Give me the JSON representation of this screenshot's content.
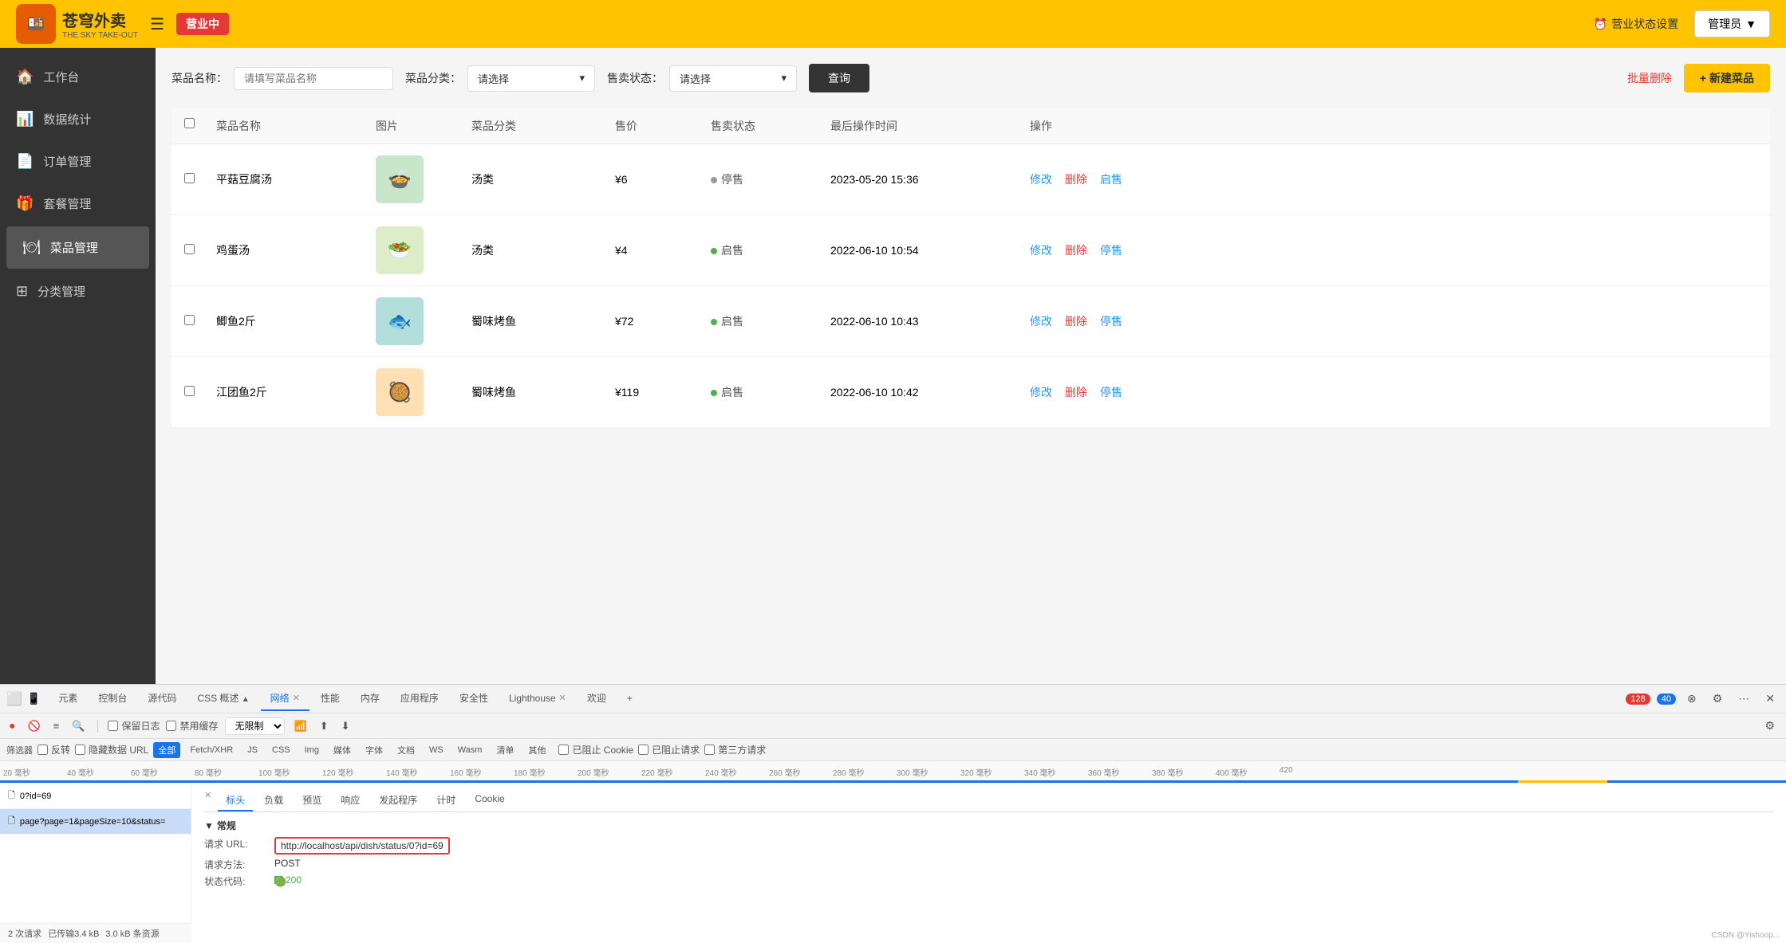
{
  "header": {
    "logo_cn": "苍穹外卖",
    "logo_en": "THE SKY TAKE-OUT",
    "menu_icon": "☰",
    "status_badge": "营业中",
    "business_status_icon": "⏰",
    "business_status_label": "营业状态设置",
    "admin_label": "管理员",
    "admin_arrow": "▼"
  },
  "sidebar": {
    "items": [
      {
        "id": "workbench",
        "icon": "🏠",
        "label": "工作台"
      },
      {
        "id": "data-stats",
        "icon": "📊",
        "label": "数据统计"
      },
      {
        "id": "order-mgmt",
        "icon": "📄",
        "label": "订单管理"
      },
      {
        "id": "combo-mgmt",
        "icon": "🎁",
        "label": "套餐管理"
      },
      {
        "id": "dish-mgmt",
        "icon": "🍽",
        "label": "菜品管理",
        "active": true
      },
      {
        "id": "category-mgmt",
        "icon": "⊞",
        "label": "分类管理"
      }
    ]
  },
  "main": {
    "filter": {
      "dish_name_label": "菜品名称：",
      "dish_name_placeholder": "请填写菜品名称",
      "category_label": "菜品分类：",
      "category_placeholder": "请选择",
      "sale_status_label": "售卖状态：",
      "sale_status_placeholder": "请选择",
      "query_btn": "查询",
      "batch_delete_btn": "批量删除",
      "new_btn": "+ 新建菜品"
    },
    "table": {
      "headers": [
        "",
        "菜品名称",
        "图片",
        "菜品分类",
        "售价",
        "售卖状态",
        "最后操作时间",
        "操作"
      ],
      "rows": [
        {
          "name": "平菇豆腐汤",
          "img_emoji": "🍲",
          "img_bg": "#c8e6c9",
          "category": "汤类",
          "price": "¥6",
          "status": "停售",
          "status_type": "stop",
          "time": "2023-05-20 15:36",
          "actions": [
            "修改",
            "删除",
            "启售"
          ]
        },
        {
          "name": "鸡蛋汤",
          "img_emoji": "🥗",
          "img_bg": "#dcedc8",
          "category": "汤类",
          "price": "¥4",
          "status": "启售",
          "status_type": "on",
          "time": "2022-06-10 10:54",
          "actions": [
            "修改",
            "删除",
            "停售"
          ]
        },
        {
          "name": "鲫鱼2斤",
          "img_emoji": "🐟",
          "img_bg": "#b2dfdb",
          "category": "蜀味烤鱼",
          "price": "¥72",
          "status": "启售",
          "status_type": "on",
          "time": "2022-06-10 10:43",
          "actions": [
            "修改",
            "删除",
            "停售"
          ]
        },
        {
          "name": "江团鱼2斤",
          "img_emoji": "🥘",
          "img_bg": "#ffe0b2",
          "category": "蜀味烤鱼",
          "price": "¥119",
          "status": "启售",
          "status_type": "on",
          "time": "2022-06-10 10:42",
          "actions": [
            "修改",
            "删除",
            "停售"
          ]
        }
      ]
    }
  },
  "devtools": {
    "tabs": [
      {
        "label": "元素",
        "active": false
      },
      {
        "label": "控制台",
        "active": false
      },
      {
        "label": "源代码",
        "active": false
      },
      {
        "label": "CSS 概述",
        "active": false,
        "has_alert": true
      },
      {
        "label": "网络",
        "active": true,
        "closeable": true
      },
      {
        "label": "性能",
        "active": false
      },
      {
        "label": "内存",
        "active": false
      },
      {
        "label": "应用程序",
        "active": false
      },
      {
        "label": "安全性",
        "active": false
      },
      {
        "label": "Lighthouse",
        "active": true,
        "closeable": true
      },
      {
        "label": "欢迎",
        "active": false
      },
      {
        "label": "+",
        "active": false
      }
    ],
    "badge_red": "128",
    "badge_blue": "40",
    "toolbar": {
      "record_icon": "⏺",
      "block_icon": "🚫",
      "clear_icon": "≡",
      "search_icon": "🔍",
      "preserve_log": "保留日志",
      "disable_cache": "禁用缓存",
      "throttle": "无限制",
      "wifi_icon": "📶",
      "upload_icon": "⬆",
      "download_icon": "⬇",
      "settings_icon": "⚙"
    },
    "filters": {
      "reverse": "反转",
      "hide_data_url": "隐藏数据 URL",
      "all": "全部",
      "fetch_xhr": "Fetch/XHR",
      "js": "JS",
      "css": "CSS",
      "img": "Img",
      "media": "媒体",
      "font": "字体",
      "doc": "文档",
      "ws": "WS",
      "wasm": "Wasm",
      "clear": "清单",
      "other": "其他",
      "blocked_cookie": "已阻止 Cookie",
      "blocked_request": "已阻止请求",
      "third_party": "第三方请求"
    },
    "timeline_labels": [
      "20 毫秒",
      "40 毫秒",
      "60 毫秒",
      "80 毫秒",
      "100 毫秒",
      "120 毫秒",
      "140 毫秒",
      "160 毫秒",
      "180 毫秒",
      "200 毫秒",
      "220 毫秒",
      "240 毫秒",
      "260 毫秒",
      "280 毫秒",
      "300 毫秒",
      "320 毫秒",
      "340 毫秒",
      "360 毫秒",
      "380 毫秒",
      "400 毫秒",
      "420"
    ],
    "request_list": [
      {
        "name": "0?id=69",
        "selected": false
      },
      {
        "name": "page?page=1&pageSize=10&status=",
        "selected": true
      }
    ],
    "detail": {
      "tabs": [
        "×",
        "标头",
        "负载",
        "预览",
        "响应",
        "发起程序",
        "计时",
        "Cookie"
      ],
      "active_tab": "标头",
      "section_title": "▼ 常规",
      "rows": [
        {
          "label": "请求 URL:",
          "value": "http://localhost/api/dish/status/0?id=69",
          "highlight": true
        },
        {
          "label": "请求方法:",
          "value": "POST"
        },
        {
          "label": "状态代码:",
          "value": "200",
          "is_status": true
        }
      ]
    },
    "footer": {
      "requests": "2 次请求",
      "transferred": "已传输3.4 kB",
      "resources": "3.0 kB 条资源"
    },
    "watermark": "CSDN @Yishoop..."
  }
}
